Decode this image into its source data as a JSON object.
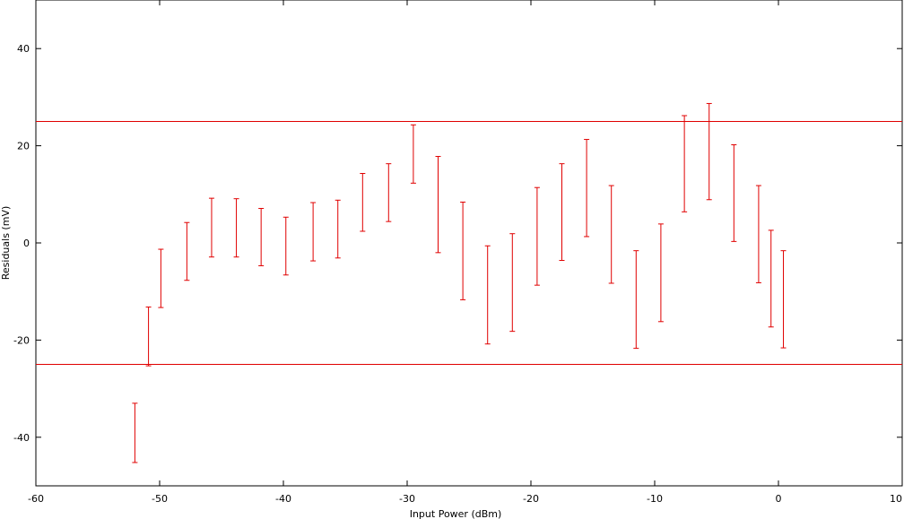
{
  "chart_data": {
    "type": "scatter",
    "title": "",
    "xlabel": "Input Power (dBm)",
    "ylabel": "Residuals (mV)",
    "xlim": [
      -60,
      10
    ],
    "ylim": [
      -50,
      50
    ],
    "xticks": [
      -60,
      -50,
      -40,
      -30,
      -20,
      -10,
      0,
      10
    ],
    "yticks": [
      -40,
      -20,
      0,
      20,
      40
    ],
    "xtick_labels": [
      "-60",
      "-50",
      "-40",
      "-30",
      "-20",
      "-10",
      "0",
      "10"
    ],
    "ytick_labels": [
      "-40",
      "-20",
      "0",
      "20",
      "40"
    ],
    "grid": false,
    "legend": "none",
    "color": "#e00000",
    "series": [
      {
        "style": "errorbars",
        "points": [
          {
            "x": -52.0,
            "low": -45.2,
            "high": -33.0
          },
          {
            "x": -50.9,
            "low": -25.3,
            "high": -13.2
          },
          {
            "x": -49.9,
            "low": -13.3,
            "high": -1.3
          },
          {
            "x": -47.8,
            "low": -7.7,
            "high": 4.2
          },
          {
            "x": -45.8,
            "low": -2.9,
            "high": 9.2
          },
          {
            "x": -43.8,
            "low": -2.9,
            "high": 9.1
          },
          {
            "x": -41.8,
            "low": -4.7,
            "high": 7.1
          },
          {
            "x": -39.8,
            "low": -6.6,
            "high": 5.3
          },
          {
            "x": -37.6,
            "low": -3.7,
            "high": 8.3
          },
          {
            "x": -35.6,
            "low": -3.1,
            "high": 8.8
          },
          {
            "x": -33.6,
            "low": 2.4,
            "high": 14.3
          },
          {
            "x": -31.5,
            "low": 4.4,
            "high": 16.3
          },
          {
            "x": -29.5,
            "low": 12.3,
            "high": 24.3
          },
          {
            "x": -27.5,
            "low": -2.0,
            "high": 17.8
          },
          {
            "x": -25.5,
            "low": -11.7,
            "high": 8.4
          },
          {
            "x": -23.5,
            "low": -20.8,
            "high": -0.6
          },
          {
            "x": -21.5,
            "low": -18.2,
            "high": 1.9
          },
          {
            "x": -19.5,
            "low": -8.7,
            "high": 11.4
          },
          {
            "x": -17.5,
            "low": -3.6,
            "high": 16.3
          },
          {
            "x": -15.5,
            "low": 1.3,
            "high": 21.3
          },
          {
            "x": -13.5,
            "low": -8.3,
            "high": 11.8
          },
          {
            "x": -11.5,
            "low": -21.7,
            "high": -1.6
          },
          {
            "x": -9.5,
            "low": -16.2,
            "high": 3.9
          },
          {
            "x": -7.6,
            "low": 6.4,
            "high": 26.2
          },
          {
            "x": -5.6,
            "low": 8.9,
            "high": 28.7
          },
          {
            "x": -3.6,
            "low": 0.3,
            "high": 20.2
          },
          {
            "x": -1.6,
            "low": -8.2,
            "high": 11.8
          },
          {
            "x": -0.6,
            "low": -17.3,
            "high": 2.6
          },
          {
            "x": 0.4,
            "low": -21.6,
            "high": -1.6
          }
        ]
      },
      {
        "style": "hline",
        "y": 25
      },
      {
        "style": "hline",
        "y": -25
      }
    ]
  }
}
